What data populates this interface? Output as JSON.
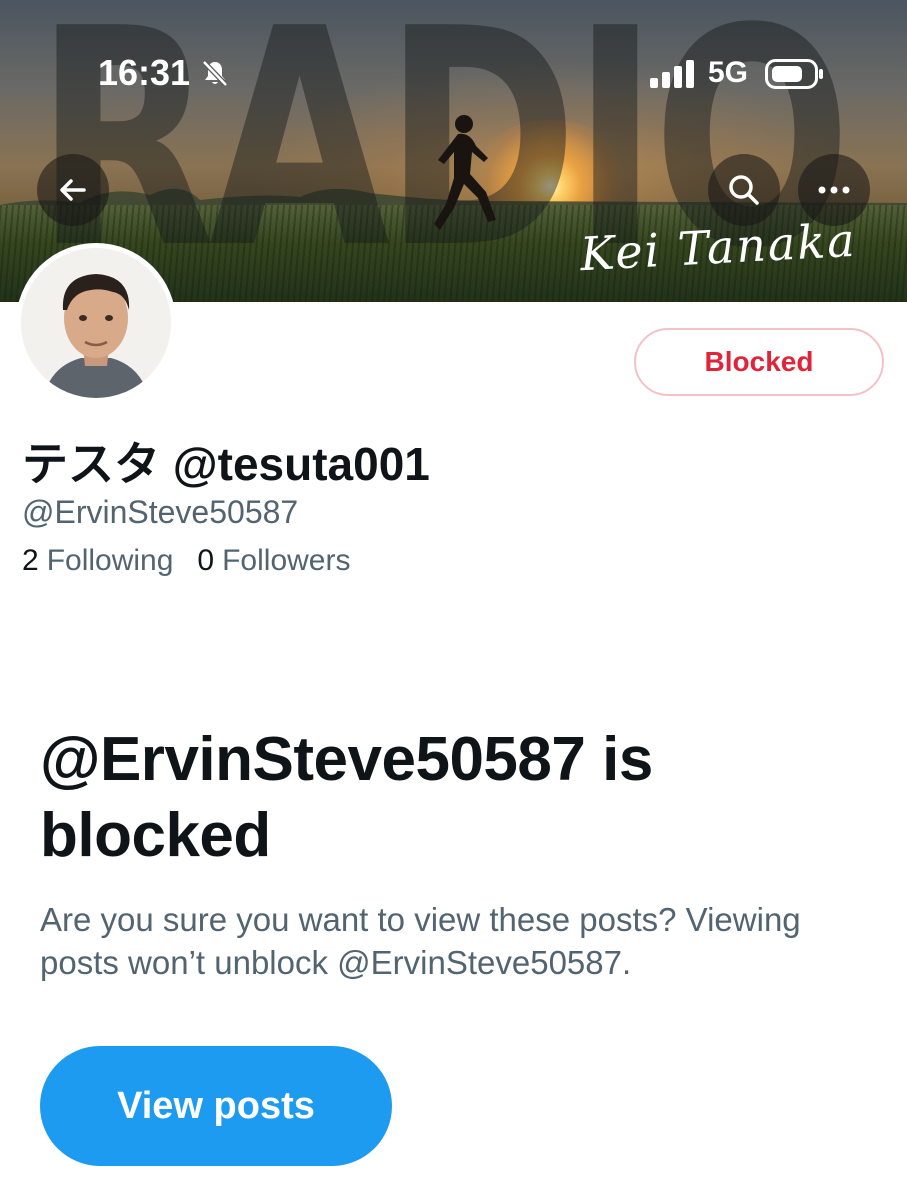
{
  "status_bar": {
    "time": "16:31",
    "network": "5G",
    "icons": [
      "bell-muted-icon",
      "signal-icon",
      "battery-icon"
    ]
  },
  "banner": {
    "overlay_text": "RADIO",
    "signature": "Kei Tanaka",
    "icons": [
      "back-arrow-icon",
      "search-icon",
      "more-icon"
    ]
  },
  "profile": {
    "display_name": "テスタ @tesuta001",
    "handle": "@ErvinSteve50587",
    "following_count": "2",
    "following_label": "Following",
    "followers_count": "0",
    "followers_label": "Followers",
    "blocked_label": "Blocked"
  },
  "blocked_notice": {
    "title": "@ErvinSteve50587 is blocked",
    "description": "Are you sure you want to view these posts? Viewing posts won’t unblock @ErvinSteve50587.",
    "button_label": "View posts"
  },
  "colors": {
    "accent": "#1d9bf0",
    "blocked_red": "#e0243a",
    "text_primary": "#0f1419",
    "text_secondary": "#536471"
  }
}
